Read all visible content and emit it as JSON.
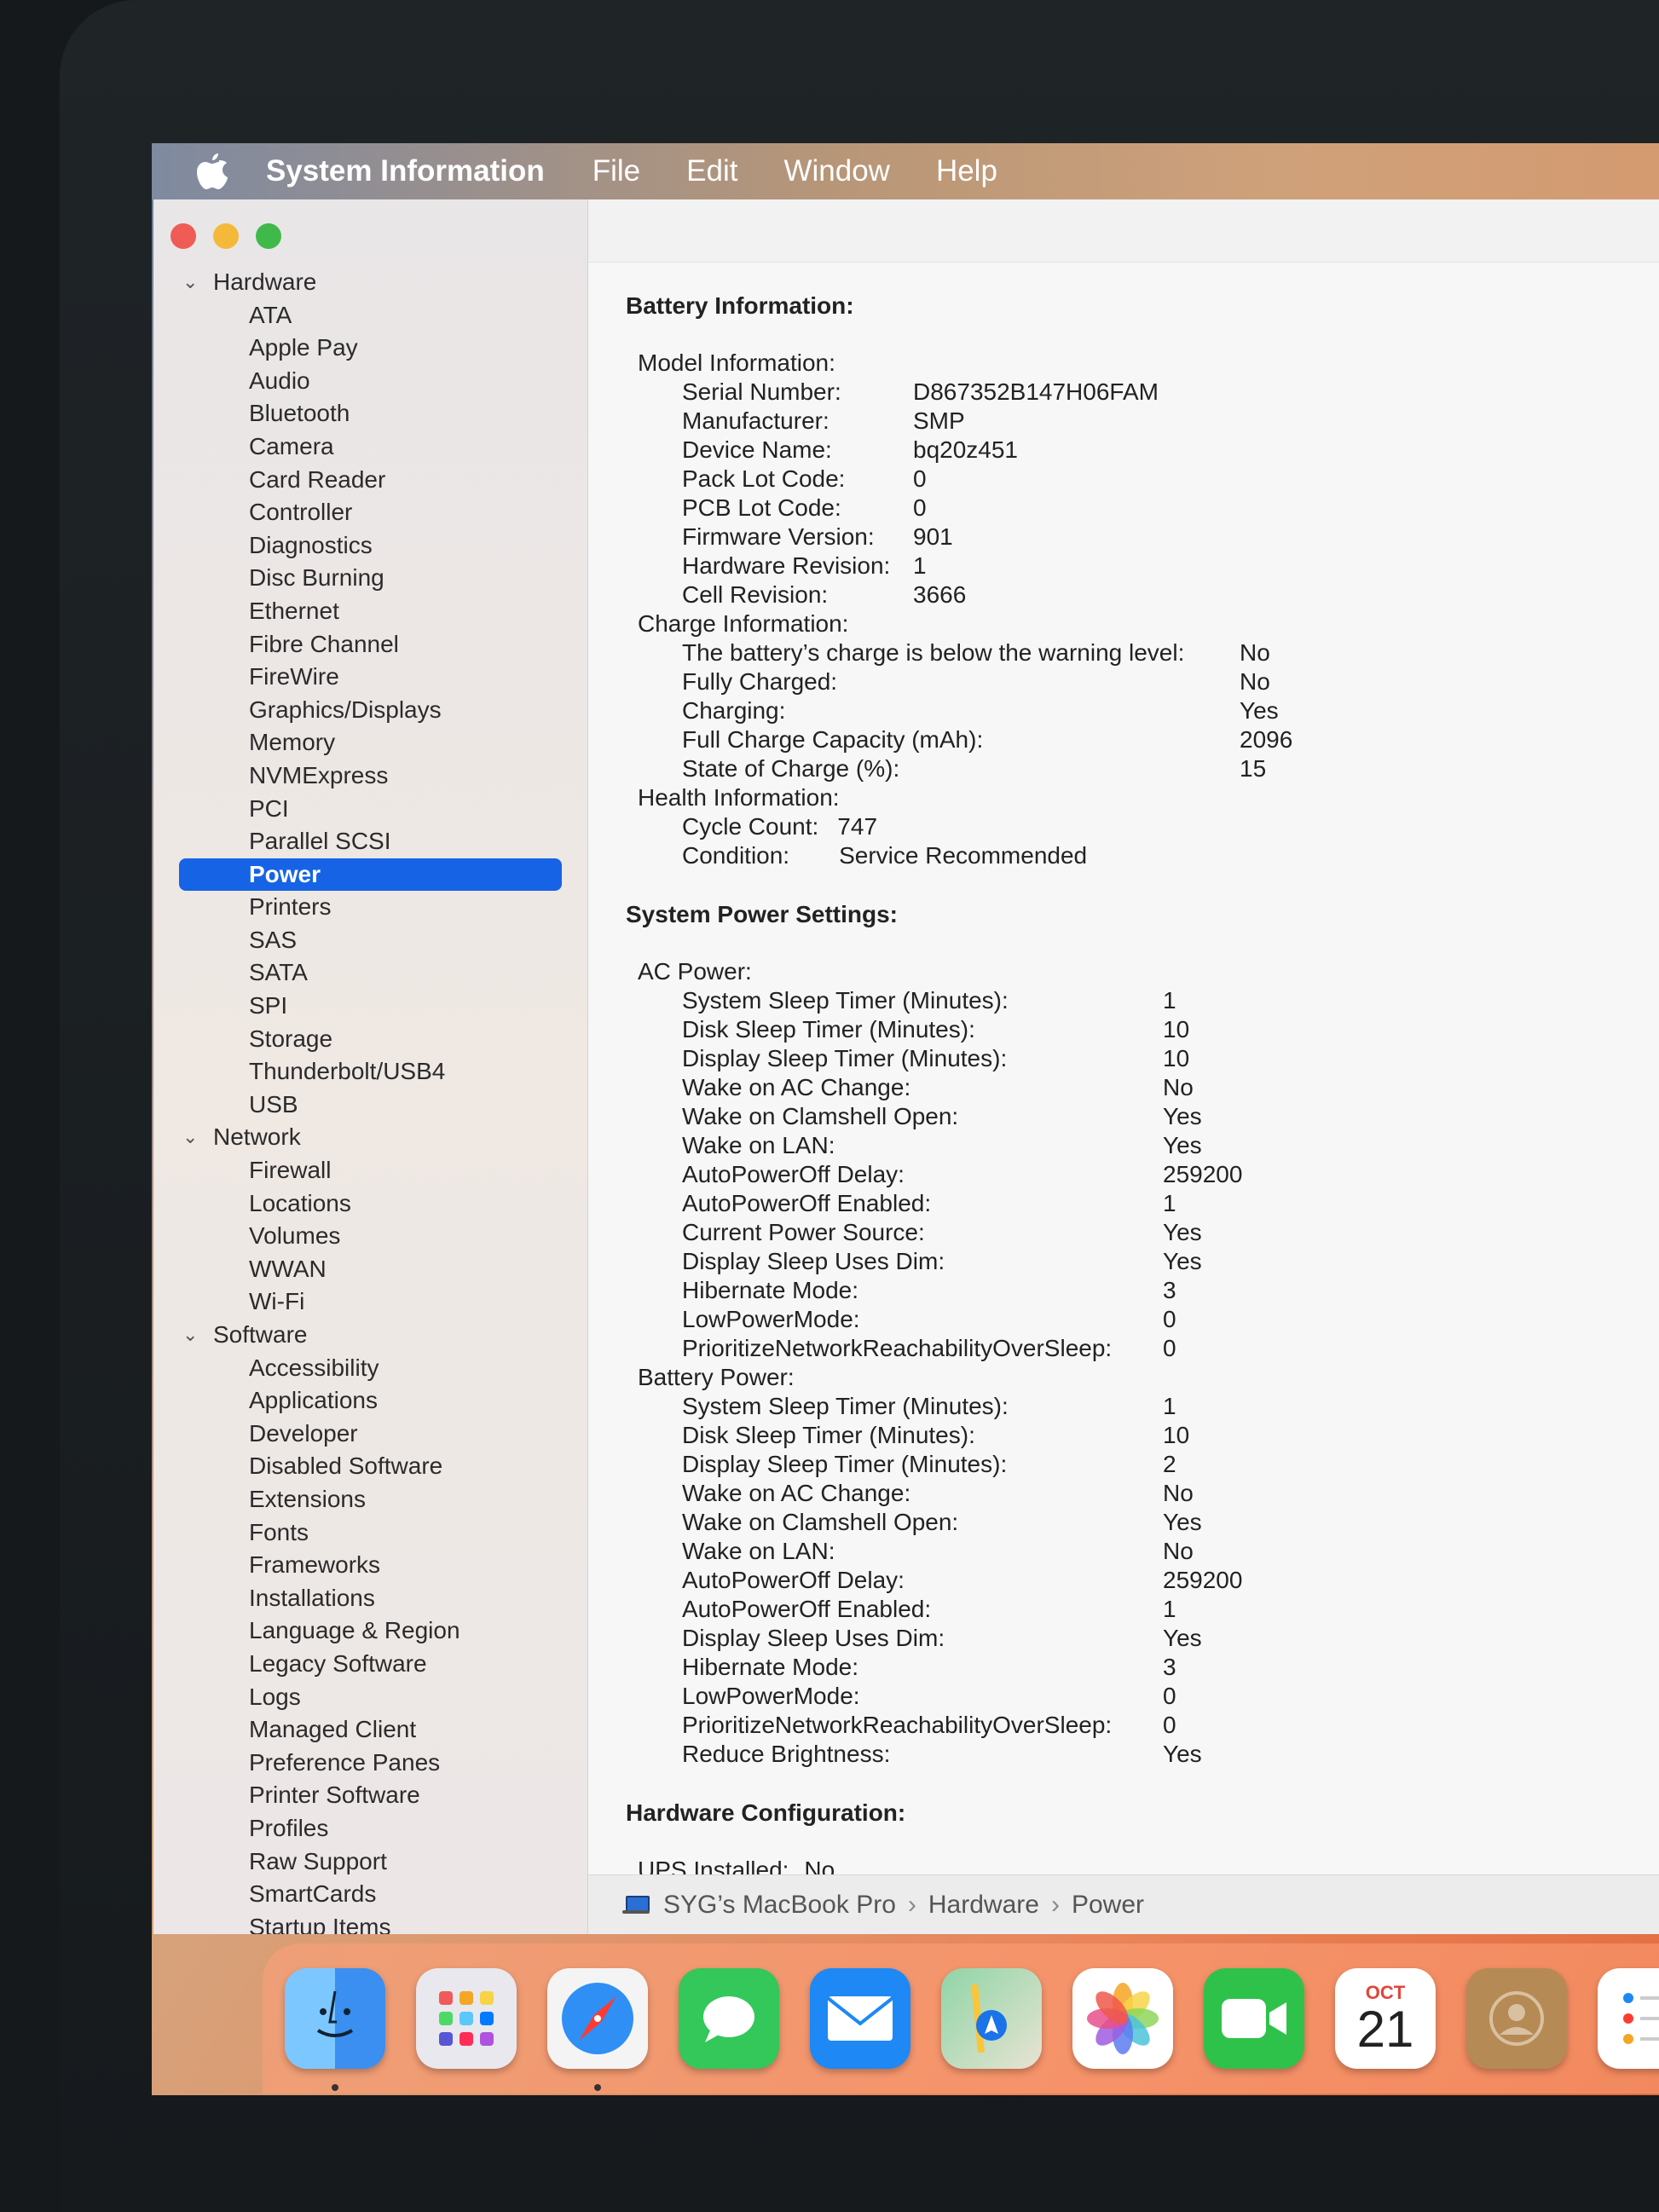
{
  "menubar": {
    "app_name": "System Information",
    "items": [
      "File",
      "Edit",
      "Window",
      "Help"
    ]
  },
  "sidebar": {
    "hardware_label": "Hardware",
    "hardware_items": [
      "ATA",
      "Apple Pay",
      "Audio",
      "Bluetooth",
      "Camera",
      "Card Reader",
      "Controller",
      "Diagnostics",
      "Disc Burning",
      "Ethernet",
      "Fibre Channel",
      "FireWire",
      "Graphics/Displays",
      "Memory",
      "NVMExpress",
      "PCI",
      "Parallel SCSI",
      "Power",
      "Printers",
      "SAS",
      "SATA",
      "SPI",
      "Storage",
      "Thunderbolt/USB4",
      "USB"
    ],
    "selected": "Power",
    "network_label": "Network",
    "network_items": [
      "Firewall",
      "Locations",
      "Volumes",
      "WWAN",
      "Wi-Fi"
    ],
    "software_label": "Software",
    "software_items": [
      "Accessibility",
      "Applications",
      "Developer",
      "Disabled Software",
      "Extensions",
      "Fonts",
      "Frameworks",
      "Installations",
      "Language & Region",
      "Legacy Software",
      "Logs",
      "Managed Client",
      "Preference Panes",
      "Printer Software",
      "Profiles",
      "Raw Support",
      "SmartCards",
      "Startup Items"
    ]
  },
  "battery": {
    "title": "Battery Information:",
    "model_head": "Model Information:",
    "model": [
      {
        "label": "Serial Number:",
        "value": "D867352B147H06FAM"
      },
      {
        "label": "Manufacturer:",
        "value": "SMP"
      },
      {
        "label": "Device Name:",
        "value": "bq20z451"
      },
      {
        "label": "Pack Lot Code:",
        "value": "0"
      },
      {
        "label": "PCB Lot Code:",
        "value": "0"
      },
      {
        "label": "Firmware Version:",
        "value": "901"
      },
      {
        "label": "Hardware Revision:",
        "value": "1"
      },
      {
        "label": "Cell Revision:",
        "value": "3666"
      }
    ],
    "charge_head": "Charge Information:",
    "charge": [
      {
        "label": "The battery’s charge is below the warning level:",
        "value": "No"
      },
      {
        "label": "Fully Charged:",
        "value": "No"
      },
      {
        "label": "Charging:",
        "value": "Yes"
      },
      {
        "label": "Full Charge Capacity (mAh):",
        "value": "2096"
      },
      {
        "label": "State of Charge (%):",
        "value": "15"
      }
    ],
    "health_head": "Health Information:",
    "health": [
      {
        "label": "Cycle Count:",
        "value": "747"
      },
      {
        "label": "Condition:",
        "value": "Service Recommended"
      }
    ]
  },
  "power": {
    "title": "System Power Settings:",
    "ac_head": "AC Power:",
    "ac": [
      {
        "label": "System Sleep Timer (Minutes):",
        "value": "1"
      },
      {
        "label": "Disk Sleep Timer (Minutes):",
        "value": "10"
      },
      {
        "label": "Display Sleep Timer (Minutes):",
        "value": "10"
      },
      {
        "label": "Wake on AC Change:",
        "value": "No"
      },
      {
        "label": "Wake on Clamshell Open:",
        "value": "Yes"
      },
      {
        "label": "Wake on LAN:",
        "value": "Yes"
      },
      {
        "label": "AutoPowerOff Delay:",
        "value": "259200"
      },
      {
        "label": "AutoPowerOff Enabled:",
        "value": "1"
      },
      {
        "label": "Current Power Source:",
        "value": "Yes"
      },
      {
        "label": "Display Sleep Uses Dim:",
        "value": "Yes"
      },
      {
        "label": "Hibernate Mode:",
        "value": "3"
      },
      {
        "label": "LowPowerMode:",
        "value": "0"
      },
      {
        "label": "PrioritizeNetworkReachabilityOverSleep:",
        "value": "0"
      }
    ],
    "battery_head": "Battery Power:",
    "battery": [
      {
        "label": "System Sleep Timer (Minutes):",
        "value": "1"
      },
      {
        "label": "Disk Sleep Timer (Minutes):",
        "value": "10"
      },
      {
        "label": "Display Sleep Timer (Minutes):",
        "value": "2"
      },
      {
        "label": "Wake on AC Change:",
        "value": "No"
      },
      {
        "label": "Wake on Clamshell Open:",
        "value": "Yes"
      },
      {
        "label": "Wake on LAN:",
        "value": "No"
      },
      {
        "label": "AutoPowerOff Delay:",
        "value": "259200"
      },
      {
        "label": "AutoPowerOff Enabled:",
        "value": "1"
      },
      {
        "label": "Display Sleep Uses Dim:",
        "value": "Yes"
      },
      {
        "label": "Hibernate Mode:",
        "value": "3"
      },
      {
        "label": "LowPowerMode:",
        "value": "0"
      },
      {
        "label": "PrioritizeNetworkReachabilityOverSleep:",
        "value": "0"
      },
      {
        "label": "Reduce Brightness:",
        "value": "Yes"
      }
    ]
  },
  "hardware_config": {
    "title": "Hardware Configuration:",
    "ups_label": "UPS Installed:",
    "ups_value": "No"
  },
  "pathbar": {
    "computer": "SYG’s MacBook Pro",
    "section": "Hardware",
    "page": "Power"
  },
  "dock": {
    "icons": [
      "finder-icon",
      "launchpad-icon",
      "safari-icon",
      "messages-icon",
      "mail-icon",
      "maps-icon",
      "photos-icon",
      "facetime-icon",
      "calendar-icon",
      "contacts-icon",
      "reminders-icon"
    ],
    "calendar_month": "OCT",
    "calendar_day": "21"
  },
  "colors": {
    "selection": "#1763e6",
    "traffic_red": "#ee5c55",
    "traffic_yellow": "#f4b93a",
    "traffic_green": "#40b94b"
  }
}
